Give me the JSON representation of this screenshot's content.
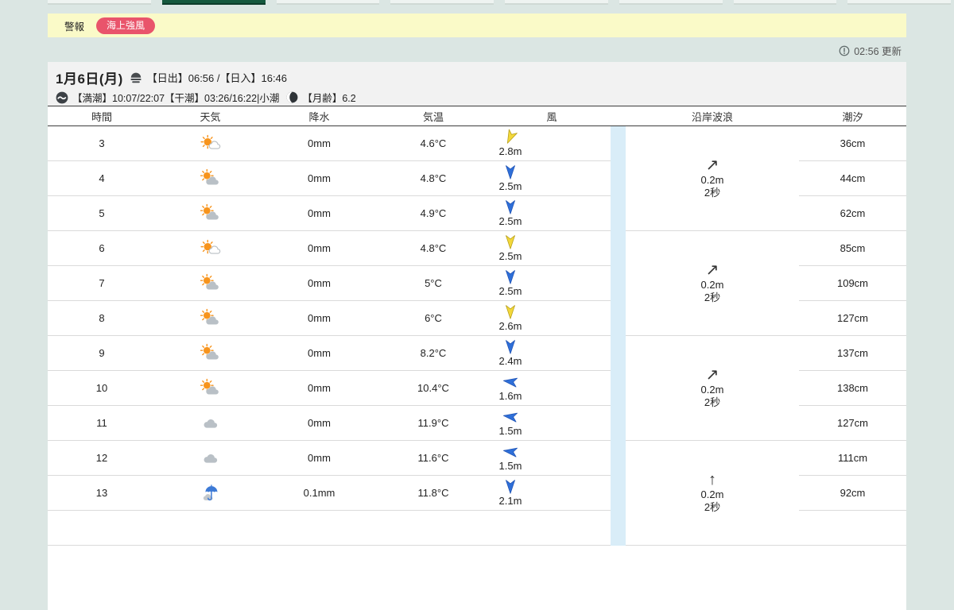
{
  "colors": {
    "page_bg": "#dbe6e3",
    "active_tab_green": "#15593e",
    "alert_bar_bg": "#fafac8",
    "badge_red": "#e9546b",
    "band_blue": "#d9edf8",
    "wind_blue": "#2e6fd9",
    "wind_yellow": "#f3d83a"
  },
  "top_tabs": {
    "count": 8,
    "active_index": 1
  },
  "alert": {
    "label": "警報",
    "badge": "海上強風"
  },
  "updated": {
    "text": "02:56 更新"
  },
  "date_header": {
    "date": "1月6日(月)",
    "sun_line": "【日出】06:56 /【日入】16:46",
    "tide_line": "【満潮】10:07/22:07【干潮】03:26/16:22|小潮",
    "moon_line": "【月齢】6.2"
  },
  "table": {
    "headers": [
      "時間",
      "天気",
      "降水",
      "気温",
      "風",
      "沿岸波浪",
      "潮汐"
    ],
    "rows": [
      {
        "time": "3",
        "weather": "sunny-then-cloudy",
        "precip": "0mm",
        "temp": "4.6°C",
        "wind": {
          "color": "yellow",
          "deg": 205,
          "speed": "2.8m"
        },
        "tide": "36cm"
      },
      {
        "time": "4",
        "weather": "partly-cloudy",
        "precip": "0mm",
        "temp": "4.8°C",
        "wind": {
          "color": "blue",
          "deg": 180,
          "speed": "2.5m"
        },
        "tide": "44cm"
      },
      {
        "time": "5",
        "weather": "partly-cloudy",
        "precip": "0mm",
        "temp": "4.9°C",
        "wind": {
          "color": "blue",
          "deg": 180,
          "speed": "2.5m"
        },
        "tide": "62cm"
      },
      {
        "time": "6",
        "weather": "sunny-then-cloudy",
        "precip": "0mm",
        "temp": "4.8°C",
        "wind": {
          "color": "yellow",
          "deg": 180,
          "speed": "2.5m"
        },
        "tide": "85cm"
      },
      {
        "time": "7",
        "weather": "partly-cloudy",
        "precip": "0mm",
        "temp": "5°C",
        "wind": {
          "color": "blue",
          "deg": 180,
          "speed": "2.5m"
        },
        "tide": "109cm"
      },
      {
        "time": "8",
        "weather": "partly-cloudy",
        "precip": "0mm",
        "temp": "6°C",
        "wind": {
          "color": "yellow",
          "deg": 180,
          "speed": "2.6m"
        },
        "tide": "127cm"
      },
      {
        "time": "9",
        "weather": "partly-cloudy",
        "precip": "0mm",
        "temp": "8.2°C",
        "wind": {
          "color": "blue",
          "deg": 180,
          "speed": "2.4m"
        },
        "tide": "137cm"
      },
      {
        "time": "10",
        "weather": "partly-cloudy",
        "precip": "0mm",
        "temp": "10.4°C",
        "wind": {
          "color": "blue",
          "deg": 278,
          "speed": "1.6m"
        },
        "tide": "138cm"
      },
      {
        "time": "11",
        "weather": "cloudy",
        "precip": "0mm",
        "temp": "11.9°C",
        "wind": {
          "color": "blue",
          "deg": 278,
          "speed": "1.5m"
        },
        "tide": "127cm"
      },
      {
        "time": "12",
        "weather": "cloudy",
        "precip": "0mm",
        "temp": "11.6°C",
        "wind": {
          "color": "blue",
          "deg": 278,
          "speed": "1.5m"
        },
        "tide": "111cm"
      },
      {
        "time": "13",
        "weather": "rain",
        "precip": "0.1mm",
        "temp": "11.8°C",
        "wind": {
          "color": "blue",
          "deg": 180,
          "speed": "2.1m"
        },
        "tide": "92cm"
      },
      {
        "time": "",
        "weather": "",
        "precip": "",
        "temp": "",
        "wind": null,
        "tide": ""
      }
    ],
    "wave_groups": [
      {
        "arrow": "↗",
        "height": "0.2m",
        "period": "2秒"
      },
      {
        "arrow": "↗",
        "height": "0.2m",
        "period": "2秒"
      },
      {
        "arrow": "↗",
        "height": "0.2m",
        "period": "2秒"
      },
      {
        "arrow": "↑",
        "height": "0.2m",
        "period": "2秒"
      }
    ]
  }
}
